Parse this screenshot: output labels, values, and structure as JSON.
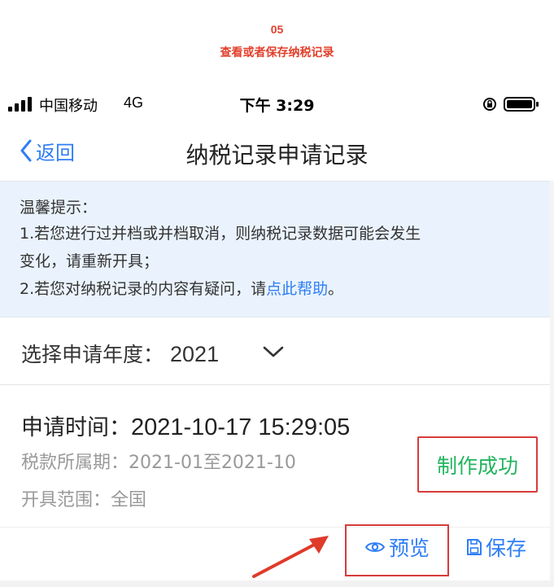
{
  "step": {
    "number": "05",
    "title": "查看或者保存纳税记录"
  },
  "status_bar": {
    "carrier": "中国移动",
    "network": "4G",
    "time": "下午 3:29"
  },
  "nav": {
    "back_label": "返回",
    "title": "纳税记录申请记录"
  },
  "notice": {
    "line1": "温馨提示：",
    "line2": "1.若您进行过并档或并档取消，则纳税记录数据可能会发生",
    "line3": "变化，请重新开具；",
    "line4_prefix": "2.若您对纳税记录的内容有疑问，请",
    "line4_link": "点此帮助",
    "line4_suffix": "。"
  },
  "year_select": {
    "label": "选择申请年度：",
    "value": "2021"
  },
  "record": {
    "apply_time_label": "申请时间：",
    "apply_time_value": "2021-10-17 15:29:05",
    "period_label": "税款所属期：",
    "period_value": "2021-01至2021-10",
    "scope_label": "开具范围：",
    "scope_value": "全国",
    "status": "制作成功",
    "preview_label": "预览",
    "save_label": "保存"
  },
  "colors": {
    "accent_blue": "#2f7ef5",
    "success_green": "#22b45d",
    "highlight_red": "#d63b3b",
    "notice_bg": "#eaf3fd"
  }
}
